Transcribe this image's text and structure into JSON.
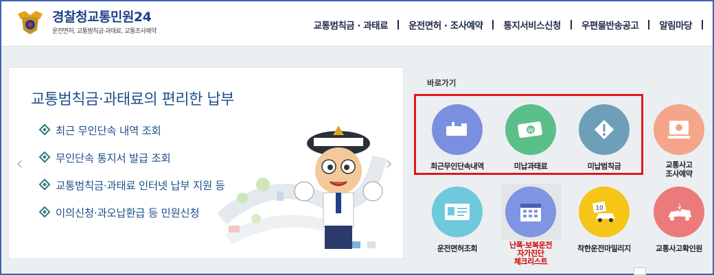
{
  "header": {
    "logo_title_main": "경찰청",
    "logo_title_accent": "교통민원24",
    "logo_subtitle": "운전면허, 교통범칙금·과태료, 교통조사예약",
    "nav": [
      {
        "label": "교통범칙금 · 과태료"
      },
      {
        "label": "운전면허 · 조사예약"
      },
      {
        "label": "통지서비스신청"
      },
      {
        "label": "우편물반송공고"
      },
      {
        "label": "알림마당"
      }
    ]
  },
  "slide": {
    "title": "교통범칙금·과태료의 편리한 납부",
    "items": [
      {
        "label": "최근 무인단속 내역 조회"
      },
      {
        "label": "무인단속 통지서 발급 조회"
      },
      {
        "label": "교통범칙금·과태료 인터넷 납부 지원 등"
      },
      {
        "label": "이의신청·과오납환급 등 민원신청"
      }
    ],
    "prev_arrow": "‹",
    "next_arrow": "›",
    "page_count": 2,
    "current_page": 1
  },
  "quick": {
    "title": "바로가기",
    "items": [
      {
        "label": "최근무인단속내역",
        "icon": "camera-icon",
        "color": "#7b8fe0"
      },
      {
        "label": "미납과태료",
        "icon": "money-icon",
        "color": "#5bbf8a"
      },
      {
        "label": "미납범칙금",
        "icon": "warning-icon",
        "color": "#6e9fb8"
      },
      {
        "label": "교통사고\n조사예약",
        "icon": "computer-icon",
        "color": "#f4a58a"
      },
      {
        "label": "운전면허조회",
        "icon": "license-card-icon",
        "color": "#6ec9dc"
      },
      {
        "label": "난폭·보복운전\n자가진단\n체크리스트",
        "icon": "calendar-checklist-icon",
        "color": "#7f94e2"
      },
      {
        "label": "착한운전마일리지",
        "icon": "mileage-car-icon",
        "color": "#f5c518"
      },
      {
        "label": "교통사고확인원",
        "icon": "car-accident-icon",
        "color": "#ec7a7a"
      }
    ]
  },
  "colors": {
    "accent_blue": "#1d4f8c",
    "highlight_red": "#e1161b"
  }
}
